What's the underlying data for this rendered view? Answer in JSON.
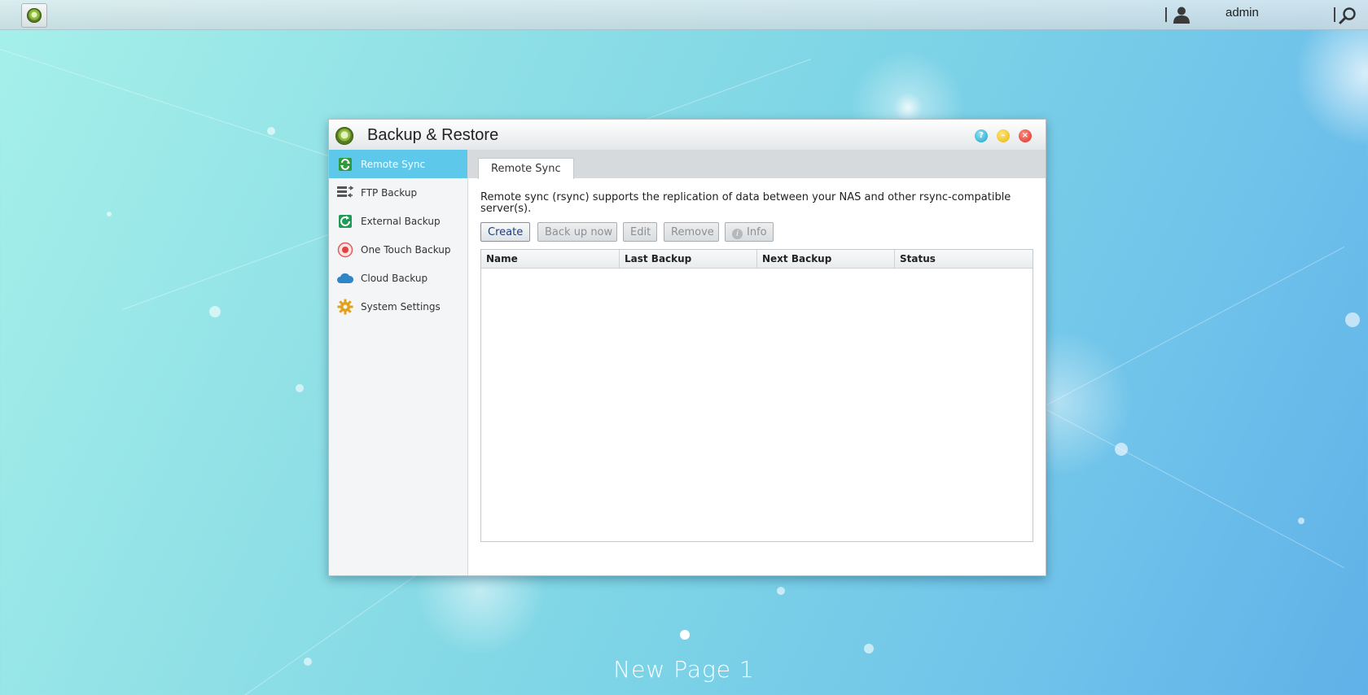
{
  "topbar": {
    "user_name": "admin"
  },
  "window": {
    "title": "Backup & Restore",
    "help_symbol": "?",
    "minimize_symbol": "–",
    "close_symbol": "×"
  },
  "sidebar": {
    "items": [
      {
        "label": "Remote Sync",
        "icon": "remote-sync-icon",
        "active": true
      },
      {
        "label": "FTP Backup",
        "icon": "ftp-backup-icon",
        "active": false
      },
      {
        "label": "External Backup",
        "icon": "external-backup-icon",
        "active": false
      },
      {
        "label": "One Touch Backup",
        "icon": "one-touch-backup-icon",
        "active": false
      },
      {
        "label": "Cloud Backup",
        "icon": "cloud-icon",
        "active": false
      },
      {
        "label": "System Settings",
        "icon": "gear-icon",
        "active": false
      }
    ]
  },
  "main": {
    "tab_label": "Remote Sync",
    "description": "Remote sync (rsync) supports the replication of data between your NAS and other rsync-compatible server(s).",
    "buttons": {
      "create": "Create",
      "backup_now": "Back up now",
      "edit": "Edit",
      "remove": "Remove",
      "info": "Info"
    },
    "table": {
      "columns": [
        "Name",
        "Last Backup",
        "Next Backup",
        "Status"
      ],
      "rows": []
    }
  },
  "desktop": {
    "page_label": "New Page 1"
  },
  "colors": {
    "active_sidebar": "#5ec8ea",
    "accent_green": "#8dba3e"
  }
}
